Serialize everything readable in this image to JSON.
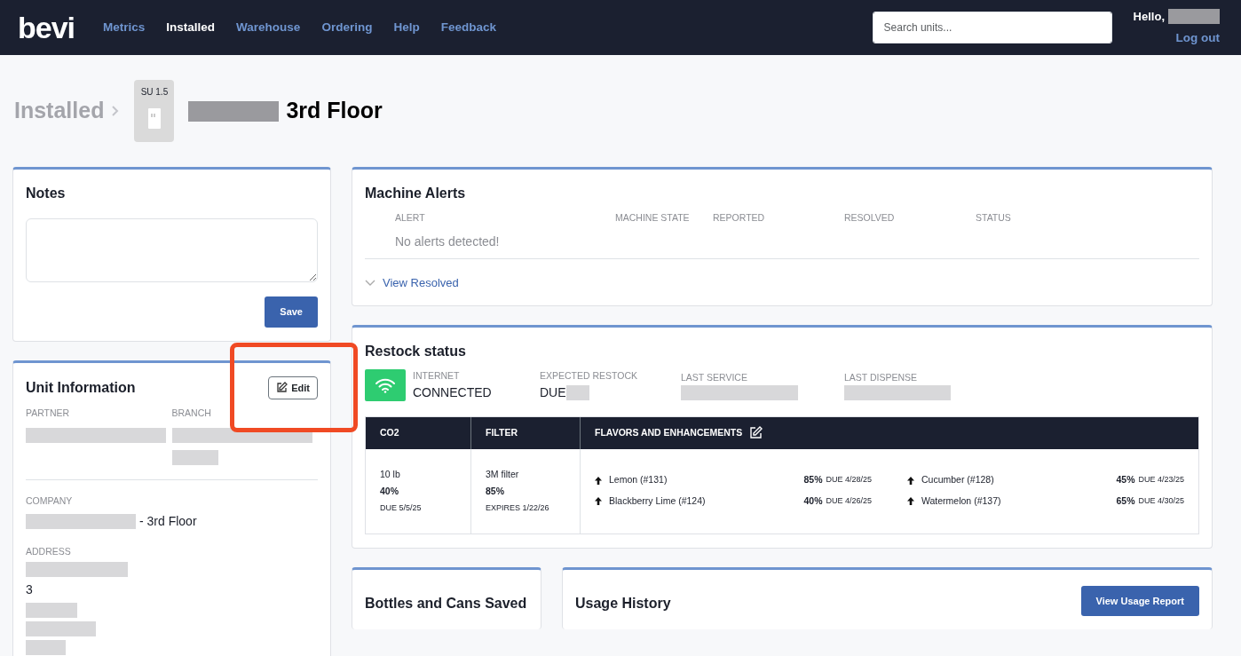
{
  "nav": {
    "logo": "bevi",
    "links": [
      {
        "label": "Metrics",
        "selected": false
      },
      {
        "label": "Installed",
        "selected": true
      },
      {
        "label": "Warehouse",
        "selected": false
      },
      {
        "label": "Ordering",
        "selected": false
      },
      {
        "label": "Help",
        "selected": false
      },
      {
        "label": "Feedback",
        "selected": false
      }
    ],
    "search": {
      "placeholder": "Search units..."
    },
    "greeting": "Hello,",
    "logout": "Log out"
  },
  "breadcrumb": {
    "parent": "Installed",
    "unit_badge": "SU 1.5",
    "title": "3rd Floor"
  },
  "notes": {
    "title": "Notes",
    "save": "Save"
  },
  "unit_info": {
    "title": "Unit Information",
    "edit": "Edit",
    "fields": [
      {
        "label": "PARTNER"
      },
      {
        "label": "BRANCH"
      },
      {
        "label": "COMPANY",
        "value": "- 3rd Floor"
      },
      {
        "label": "ADDRESS",
        "value": "3"
      }
    ]
  },
  "alerts": {
    "title": "Machine Alerts",
    "columns": [
      "ALERT",
      "MACHINE STATE",
      "REPORTED",
      "RESOLVED",
      "STATUS"
    ],
    "empty": "No alerts detected!",
    "view_resolved": "View Resolved",
    "expanded": false
  },
  "restock": {
    "title": "Restock status",
    "stats": [
      {
        "label": "INTERNET",
        "value": "CONNECTED"
      },
      {
        "label": "EXPECTED RESTOCK",
        "value": "DUE"
      },
      {
        "label": "LAST SERVICE"
      },
      {
        "label": "LAST DISPENSE"
      }
    ],
    "columns": [
      "CO2",
      "FILTER",
      "FLAVORS AND ENHANCEMENTS"
    ],
    "co2": {
      "amount": "10 lb",
      "percent": "40%",
      "due": "DUE 5/5/25"
    },
    "filter": {
      "amount": "3M filter",
      "percent": "85%",
      "due": "EXPIRES 1/22/26"
    },
    "flavors": [
      {
        "name": "Lemon (#131)",
        "percent": "85%",
        "due": "DUE 4/28/25"
      },
      {
        "name": "Cucumber (#128)",
        "percent": "45%",
        "due": "DUE 4/23/25"
      },
      {
        "name": "Blackberry Lime (#124)",
        "percent": "40%",
        "due": "DUE 4/26/25"
      },
      {
        "name": "Watermelon (#137)",
        "percent": "65%",
        "due": "DUE 4/30/25"
      }
    ]
  },
  "bottles": {
    "title": "Bottles and Cans Saved"
  },
  "usage": {
    "title": "Usage History",
    "button": "View Usage Report"
  }
}
